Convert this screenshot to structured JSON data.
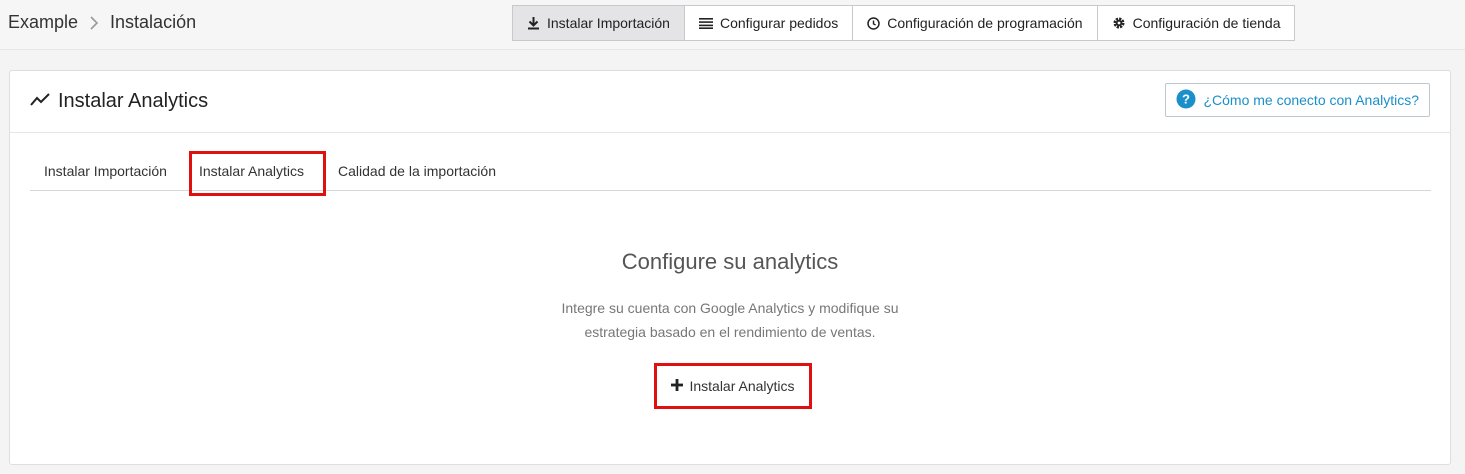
{
  "breadcrumb": {
    "root": "Example",
    "current": "Instalación"
  },
  "topnav": [
    {
      "label": "Instalar Importación",
      "icon": "download-icon",
      "active": true
    },
    {
      "label": "Configurar pedidos",
      "icon": "list-icon",
      "active": false
    },
    {
      "label": "Configuración de programación",
      "icon": "clock-icon",
      "active": false
    },
    {
      "label": "Configuración de tienda",
      "icon": "gear-icon",
      "active": false
    }
  ],
  "card": {
    "title": "Instalar Analytics",
    "title_icon": "trend-line-icon",
    "help_label": "¿Cómo me conecto con Analytics?",
    "help_icon": "question-circle-icon"
  },
  "tabs": [
    {
      "label": "Instalar Importación",
      "active": false
    },
    {
      "label": "Instalar Analytics",
      "active": true
    },
    {
      "label": "Calidad de la importación",
      "active": false
    }
  ],
  "empty_state": {
    "title": "Configure su analytics",
    "description": "Integre su cuenta con Google Analytics y modifique su estrategia basado en el rendimiento de ventas.",
    "button_label": "Instalar Analytics",
    "button_icon": "plus-icon"
  },
  "colors": {
    "accent": "#1a8fc9",
    "highlight": "#e01010"
  }
}
